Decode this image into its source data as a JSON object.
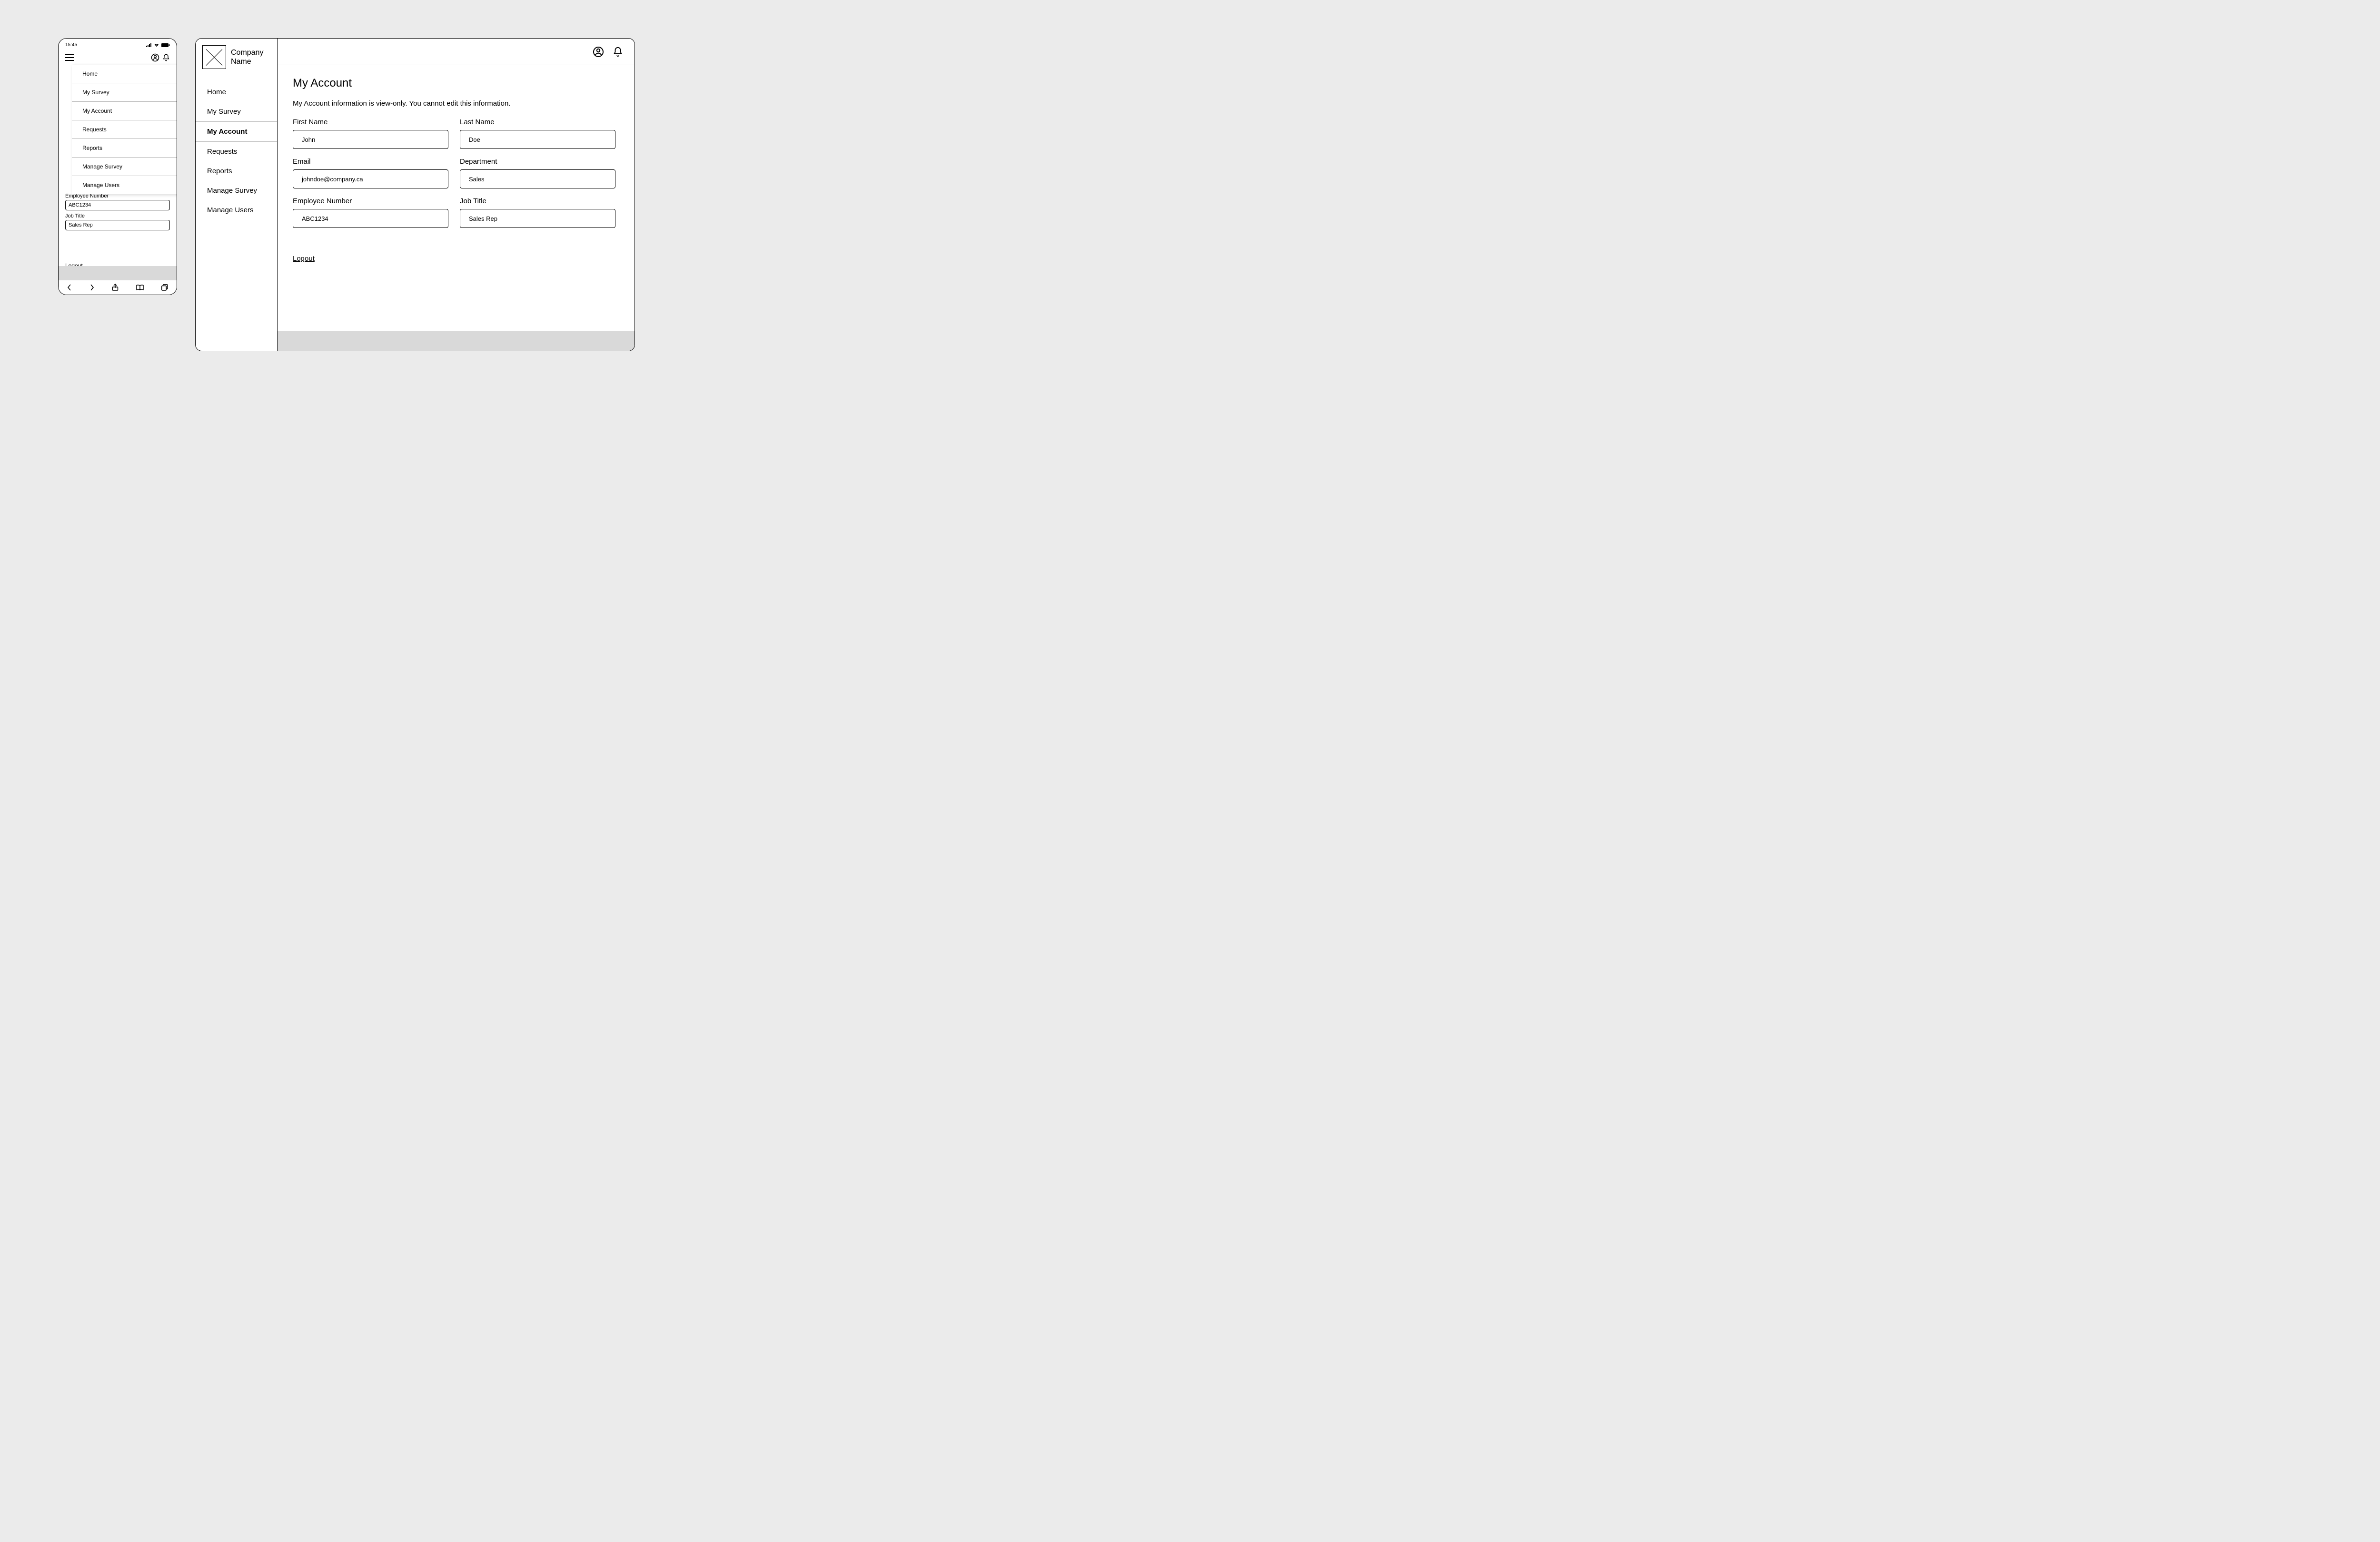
{
  "mobile": {
    "status": {
      "time": "15:45"
    },
    "menu": {
      "items": [
        {
          "label": "Home"
        },
        {
          "label": "My Survey"
        },
        {
          "label": "My Account"
        },
        {
          "label": "Requests"
        },
        {
          "label": "Reports"
        },
        {
          "label": "Manage Survey"
        },
        {
          "label": "Manage Users"
        }
      ]
    },
    "visible_fields": {
      "employee_number": {
        "label": "Employee Number",
        "value": "ABC1234"
      },
      "job_title": {
        "label": "Job Title",
        "value": "Sales Rep"
      }
    },
    "logout": "Logout"
  },
  "desktop": {
    "company": "Company Name",
    "nav": [
      {
        "label": "Home",
        "active": false
      },
      {
        "label": "My Survey",
        "active": false
      },
      {
        "label": "My Account",
        "active": true
      },
      {
        "label": "Requests",
        "active": false
      },
      {
        "label": "Reports",
        "active": false
      },
      {
        "label": "Manage Survey",
        "active": false
      },
      {
        "label": "Manage Users",
        "active": false
      }
    ],
    "page": {
      "title": "My Account",
      "subtitle": "My Account information is view-only. You cannot edit this information.",
      "fields": {
        "first_name": {
          "label": "First Name",
          "value": "John"
        },
        "last_name": {
          "label": "Last Name",
          "value": "Doe"
        },
        "email": {
          "label": "Email",
          "value": "johndoe@company.ca"
        },
        "department": {
          "label": "Department",
          "value": "Sales"
        },
        "employee_number": {
          "label": "Employee Number",
          "value": "ABC1234"
        },
        "job_title": {
          "label": "Job Title",
          "value": "Sales Rep"
        }
      },
      "logout": "Logout"
    }
  }
}
